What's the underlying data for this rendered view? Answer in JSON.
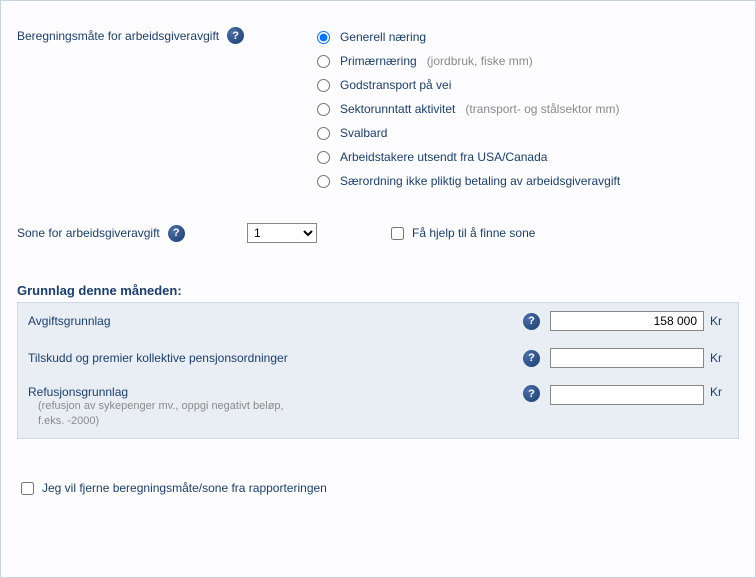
{
  "beregning": {
    "label": "Beregningsmåte for arbeidsgiveravgift",
    "options": [
      {
        "label": "Generell næring",
        "hint": ""
      },
      {
        "label": "Primærnæring",
        "hint": "(jordbruk, fiske mm)"
      },
      {
        "label": "Godstransport på vei",
        "hint": ""
      },
      {
        "label": "Sektorunntatt aktivitet",
        "hint": "(transport- og stålsektor mm)"
      },
      {
        "label": "Svalbard",
        "hint": ""
      },
      {
        "label": "Arbeidstakere utsendt fra USA/Canada",
        "hint": ""
      },
      {
        "label": "Særordning ikke pliktig betaling av arbeidsgiveravgift",
        "hint": ""
      }
    ],
    "selected_index": 0
  },
  "zone": {
    "label": "Sone for arbeidsgiveravgift",
    "selected": "1",
    "help_label": "Få hjelp til å finne sone"
  },
  "grunnlag": {
    "title": "Grunnlag denne måneden:",
    "rows": [
      {
        "label": "Avgiftsgrunnlag",
        "sub": "",
        "value": "158 000",
        "suffix": "Kr"
      },
      {
        "label": "Tilskudd og premier kollektive pensjonsordninger",
        "sub": "",
        "value": "",
        "suffix": "Kr"
      },
      {
        "label": "Refusjonsgrunnlag",
        "sub": "(refusjon av sykepenger mv., oppgi negativt beløp, f.eks. -2000)",
        "value": "",
        "suffix": "Kr"
      }
    ]
  },
  "remove": {
    "label": "Jeg vil fjerne beregningsmåte/sone fra rapporteringen"
  },
  "help_glyph": "?"
}
